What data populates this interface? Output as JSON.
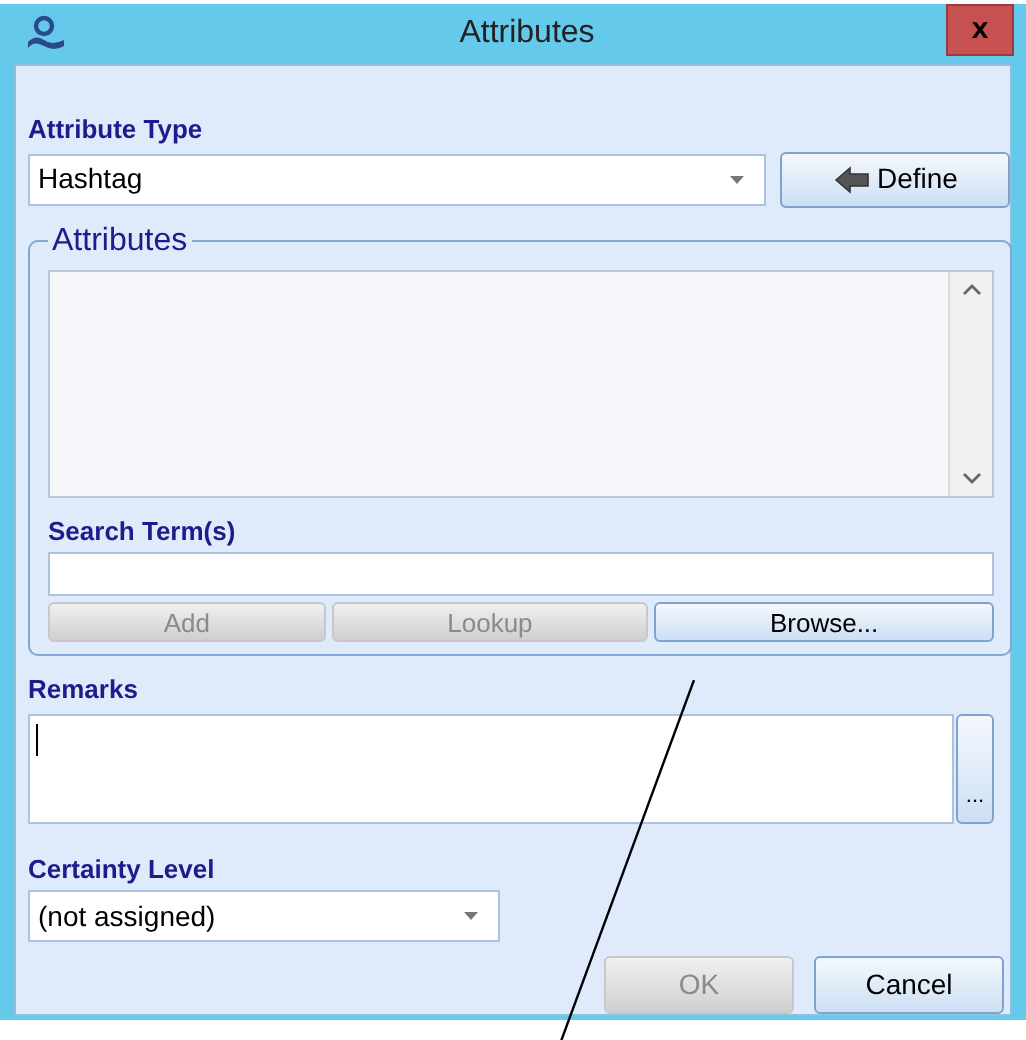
{
  "window": {
    "title": "Attributes",
    "close_button": "x"
  },
  "attribute_type": {
    "label": "Attribute Type",
    "value": "Hashtag"
  },
  "define_button": {
    "label": "Define",
    "disabled": false
  },
  "attributes_group": {
    "title": "Attributes",
    "search_label": "Search Term(s)",
    "buttons": [
      {
        "label": "Add",
        "disabled": true
      },
      {
        "label": "Lookup",
        "disabled": true
      },
      {
        "label": "Browse...",
        "disabled": false
      }
    ]
  },
  "remarks": {
    "label": "Remarks",
    "more_button": "..."
  },
  "certainty": {
    "label": "Certainty Level",
    "value": "(not assigned)"
  },
  "buttons": [
    {
      "label": "OK",
      "disabled": true
    },
    {
      "label": "Cancel",
      "disabled": false
    }
  ]
}
